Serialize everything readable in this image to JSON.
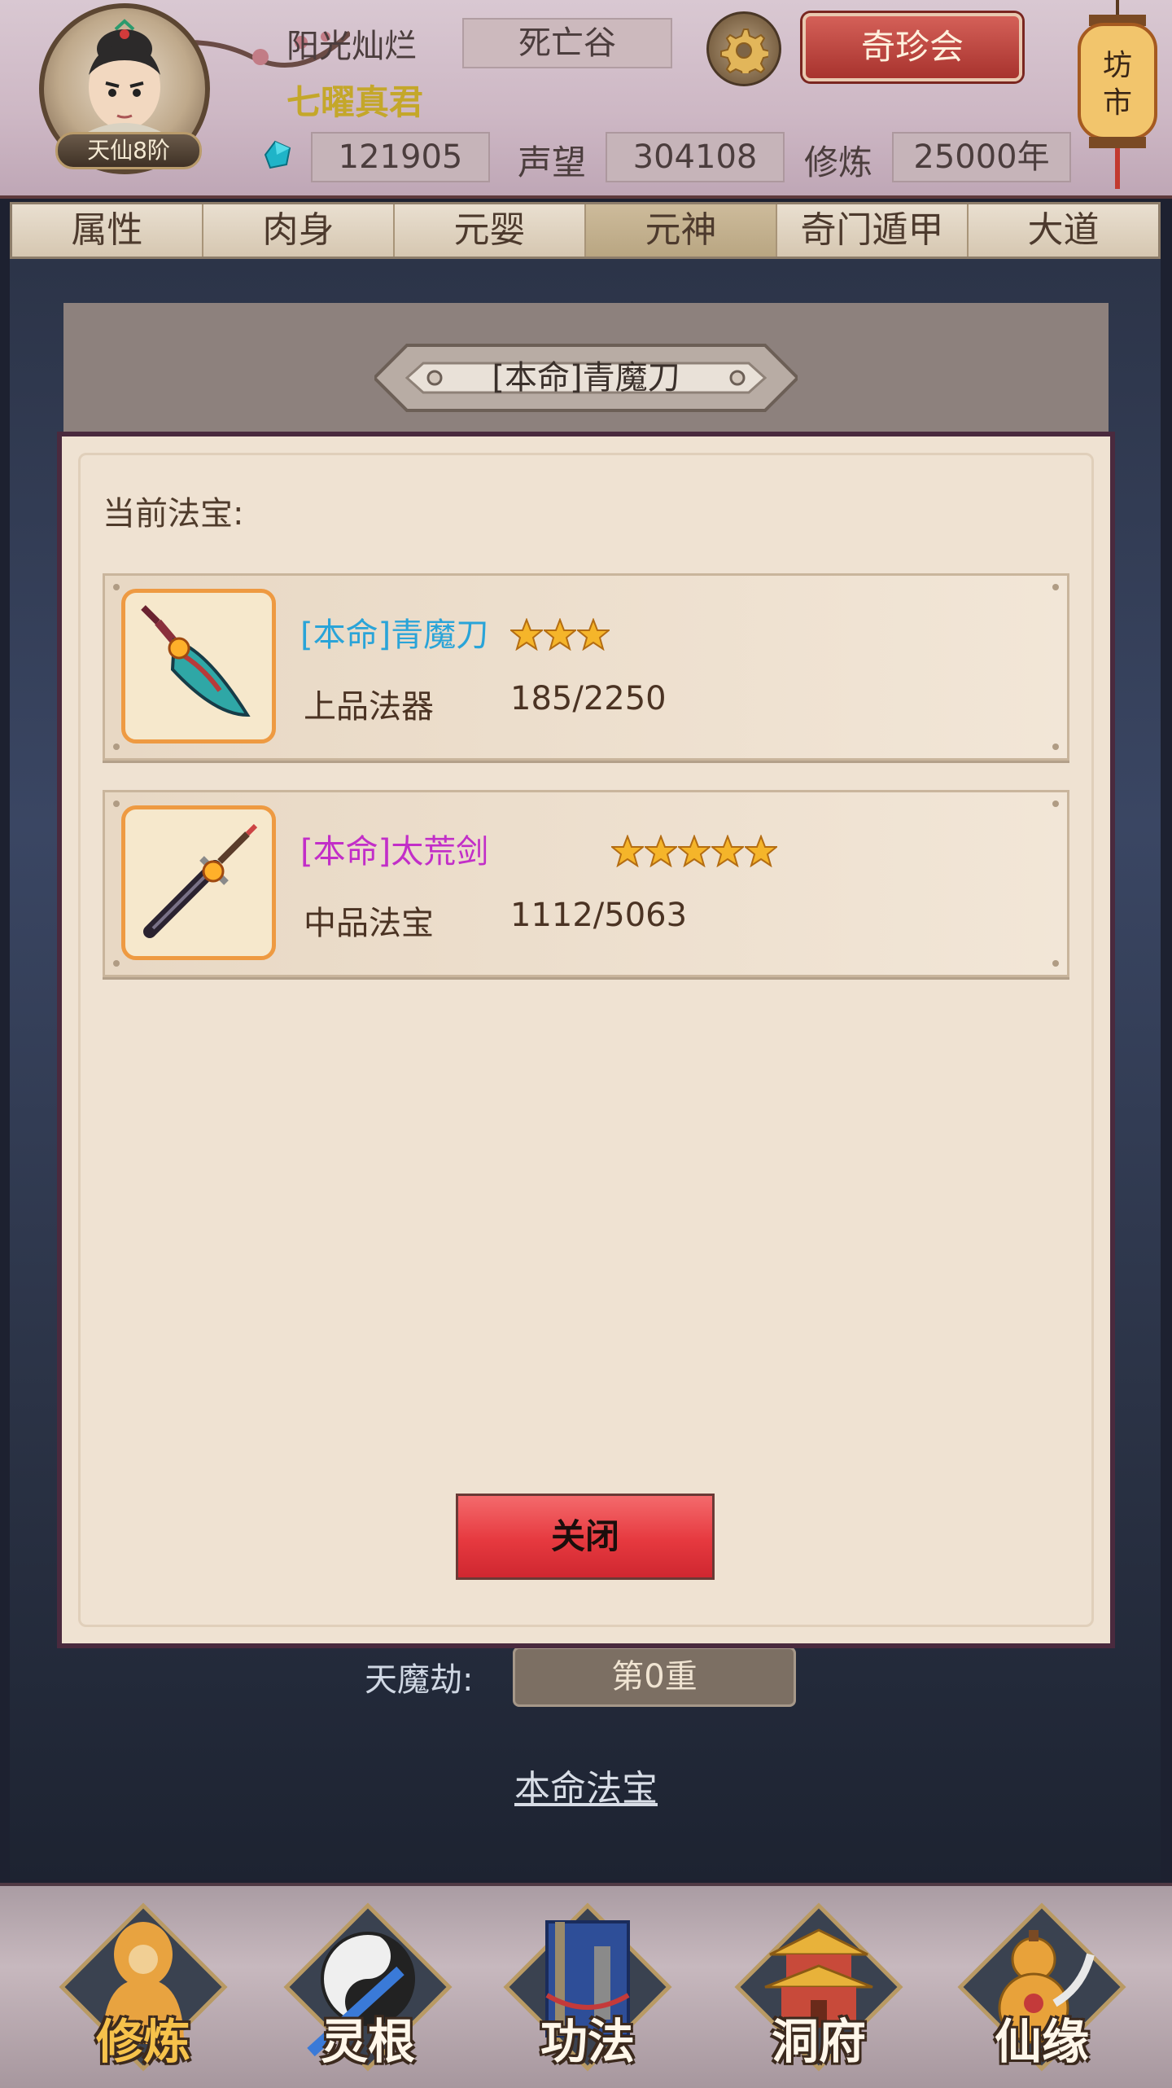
{
  "player": {
    "name": "阳光灿烂",
    "title": "七曜真君",
    "rank": "天仙8阶",
    "location": "死亡谷"
  },
  "header": {
    "treasure_button": "奇珍会",
    "market_label": "坊市",
    "jade_value": "121905",
    "reputation_label": "声望",
    "reputation_value": "304108",
    "cultivation_label": "修炼",
    "cultivation_value": "25000年"
  },
  "tabs": [
    {
      "label": "属性",
      "active": false
    },
    {
      "label": "肉身",
      "active": false
    },
    {
      "label": "元婴",
      "active": false
    },
    {
      "label": "元神",
      "active": true
    },
    {
      "label": "奇门遁甲",
      "active": false
    },
    {
      "label": "大道",
      "active": false
    }
  ],
  "dialog": {
    "title": "[本命]青魔刀",
    "section_label": "当前法宝:",
    "items": [
      {
        "name": "[本命]青魔刀",
        "name_color": "#2aa4d8",
        "stars": 3,
        "grade": "上品法器",
        "progress": "185/2250",
        "icon": "blade-icon"
      },
      {
        "name": "[本命]太荒剑",
        "name_color": "#c22ec8",
        "stars": 5,
        "grade": "中品法宝",
        "progress": "1112/5063",
        "icon": "sword-icon"
      }
    ],
    "close_button": "关闭"
  },
  "background": {
    "tribulation_label": "天魔劫:",
    "tribulation_value": "第0重",
    "link": "本命法宝"
  },
  "bottom_nav": [
    {
      "label": "修炼",
      "active": true,
      "icon": "cultivator-icon"
    },
    {
      "label": "灵根",
      "active": false,
      "icon": "yin-yang-icon"
    },
    {
      "label": "功法",
      "active": false,
      "icon": "scroll-book-icon"
    },
    {
      "label": "洞府",
      "active": false,
      "icon": "pagoda-icon"
    },
    {
      "label": "仙缘",
      "active": false,
      "icon": "gourd-icon"
    }
  ],
  "colors": {
    "accent_red": "#e6393f",
    "title_gold": "#c4a72a",
    "frame_orange": "#ee9a42"
  }
}
